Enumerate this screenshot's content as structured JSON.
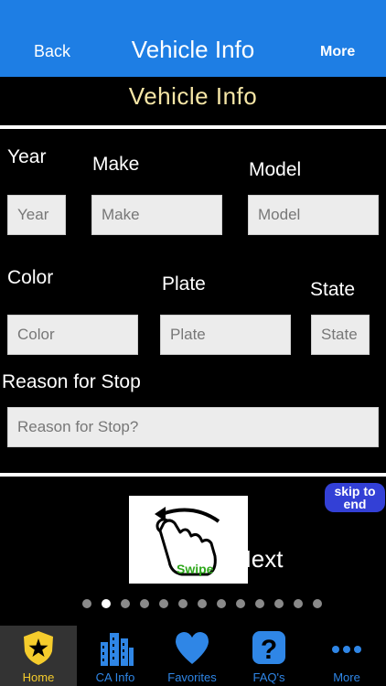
{
  "nav": {
    "back": "Back",
    "title": "Vehicle Info",
    "more": "More"
  },
  "section_title": "Vehicle Info",
  "form": {
    "year_label": "Year",
    "year_placeholder": "Year",
    "make_label": "Make",
    "make_placeholder": "Make",
    "model_label": "Model",
    "model_placeholder": "Model",
    "color_label": "Color",
    "color_placeholder": "Color",
    "plate_label": "Plate",
    "plate_placeholder": "Plate",
    "state_label": "State",
    "state_placeholder": "State",
    "reason_label": "Reason for Stop",
    "reason_placeholder": "Reason for Stop?"
  },
  "skip_button": "skip to\nend",
  "swipe": {
    "hint": "Swipe",
    "next_label": "Next"
  },
  "pager": {
    "total": 13,
    "active_index": 1
  },
  "tabs": [
    {
      "label": "Home",
      "icon": "shield-star-icon"
    },
    {
      "label": "CA Info",
      "icon": "buildings-icon"
    },
    {
      "label": "Favorites",
      "icon": "heart-icon"
    },
    {
      "label": "FAQ's",
      "icon": "question-icon"
    },
    {
      "label": "More",
      "icon": "ellipsis-icon"
    }
  ],
  "colors": {
    "nav": "#1e7ee4",
    "accent_title": "#f6e6a6",
    "tab_active": "#f5cc2c",
    "tab": "#2f86e6",
    "skip": "#3340d6",
    "swipe_green": "#2fa81c"
  }
}
